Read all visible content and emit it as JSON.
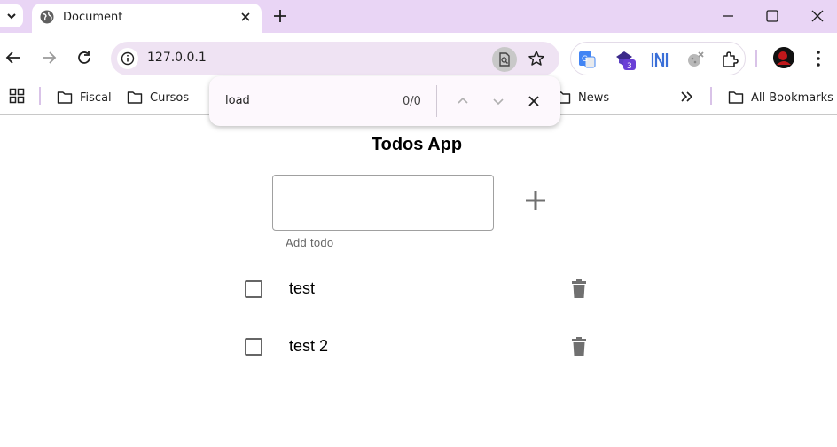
{
  "browser": {
    "tab_title": "Document",
    "url": "127.0.0.1",
    "extension_badge": "3"
  },
  "bookmarks": {
    "items": [
      "Fiscal",
      "Cursos",
      "News"
    ],
    "all_bookmarks": "All Bookmarks"
  },
  "find_bar": {
    "query": "load",
    "count": "0/0"
  },
  "app": {
    "title": "Todos App",
    "input_value": "",
    "input_helper": "Add todo",
    "todos": [
      {
        "text": "test",
        "done": false
      },
      {
        "text": "test 2",
        "done": false
      }
    ]
  },
  "colors": {
    "tabstrip": "#e9d5f5",
    "omnibox": "#efe3f3",
    "icon_gray": "#707070"
  }
}
